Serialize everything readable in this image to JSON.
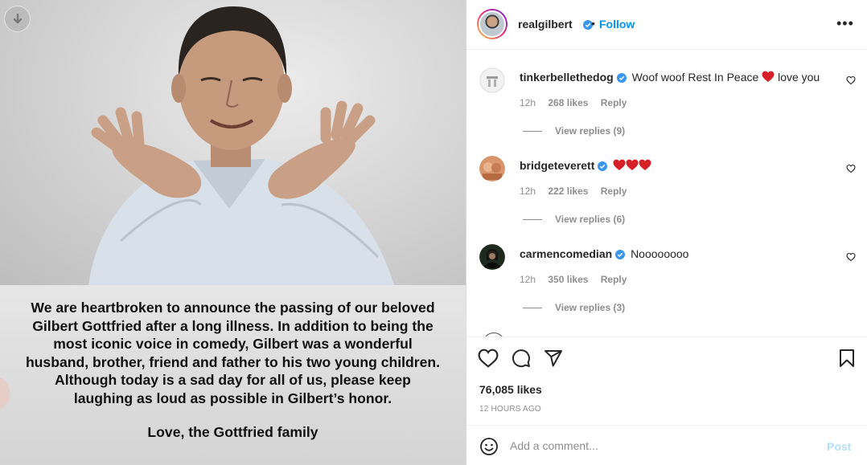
{
  "media": {
    "announcement_lines": [
      "We are heartbroken to announce the passing of our beloved",
      "Gilbert Gottfried after a long illness.  In addition to being the",
      "most iconic voice in comedy, Gilbert was a wonderful",
      "husband, brother, friend and father to his two young children.",
      "Although today is a sad day for all of us, please keep",
      "laughing as loud as possible in Gilbert’s honor."
    ],
    "signoff": "Love, the Gottfried family"
  },
  "header": {
    "username": "realgilbert",
    "separator": "•",
    "follow_label": "Follow",
    "more_label": "•••"
  },
  "comments": [
    {
      "username": "tinkerbellethedog",
      "text_before": "Woof woof Rest In Peace",
      "text_after": "love you",
      "hearts": 1,
      "time": "12h",
      "likes": "268 likes",
      "reply_label": "Reply",
      "view_replies": "View replies (9)"
    },
    {
      "username": "bridgeteverett",
      "text_before": "",
      "text_after": "",
      "hearts": 3,
      "time": "12h",
      "likes": "222 likes",
      "reply_label": "Reply",
      "view_replies": "View replies (6)"
    },
    {
      "username": "carmencomedian",
      "text_before": "Noooooooo",
      "text_after": "",
      "hearts": 0,
      "time": "12h",
      "likes": "350 likes",
      "reply_label": "Reply",
      "view_replies": "View replies (3)"
    }
  ],
  "actions": {
    "likes": "76,085 likes",
    "timestamp": "12 HOURS AGO"
  },
  "add_comment": {
    "placeholder": "Add a comment...",
    "post_label": "Post"
  },
  "colors": {
    "accent": "#0095f6",
    "verified": "#3897f0",
    "heart_emoji": "#d61f26",
    "post_disabled": "#b2dffc"
  }
}
